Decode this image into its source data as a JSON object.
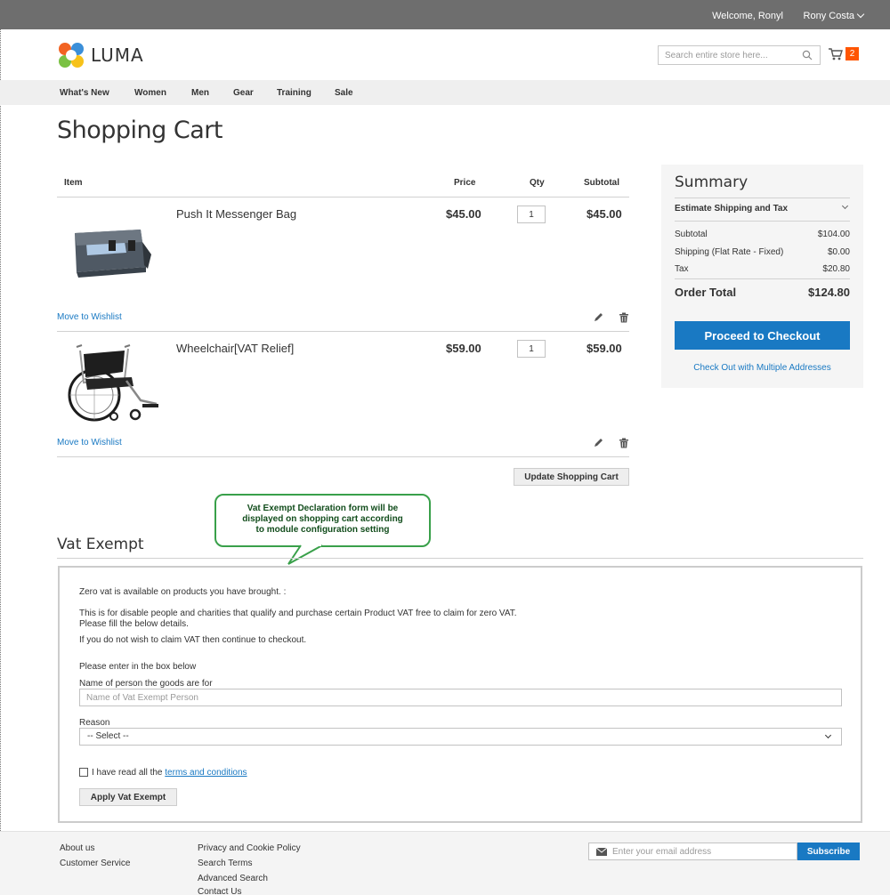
{
  "header": {
    "welcome": "Welcome, Ronyl",
    "user_name": "Rony Costa",
    "logo_text": "LUMA",
    "search_placeholder": "Search entire store here...",
    "cart_count": "2"
  },
  "nav": {
    "items": [
      "What's New",
      "Women",
      "Men",
      "Gear",
      "Training",
      "Sale"
    ]
  },
  "page_title": "Shopping Cart",
  "cart": {
    "columns": {
      "item": "Item",
      "price": "Price",
      "qty": "Qty",
      "subtotal": "Subtotal"
    },
    "items": [
      {
        "name": "Push It Messenger Bag",
        "price": "$45.00",
        "qty": "1",
        "subtotal": "$45.00",
        "wishlist": "Move to Wishlist"
      },
      {
        "name": "Wheelchair[VAT Relief]",
        "price": "$59.00",
        "qty": "1",
        "subtotal": "$59.00",
        "wishlist": "Move to Wishlist"
      }
    ],
    "update_label": "Update Shopping Cart"
  },
  "summary": {
    "title": "Summary",
    "estimate": "Estimate Shipping and Tax",
    "rows": [
      {
        "label": "Subtotal",
        "value": "$104.00"
      },
      {
        "label": "Shipping (Flat Rate - Fixed)",
        "value": "$0.00"
      },
      {
        "label": "Tax",
        "value": "$20.80"
      }
    ],
    "total_label": "Order Total",
    "total_value": "$124.80",
    "checkout_label": "Proceed to Checkout",
    "multi_label": "Check Out with Multiple Addresses"
  },
  "callout": {
    "line1": "Vat Exempt Declaration form will be",
    "line2": "displayed on shopping cart according",
    "line3": "to module configuration setting"
  },
  "vat": {
    "title": "Vat Exempt",
    "line1": "Zero vat is available on products you have brought. :",
    "line2": "This is for disable people and charities that qualify and purchase certain Product VAT free to claim for zero VAT.",
    "line3": "Please fill the below details.",
    "line4": "If you do not wish to claim VAT then continue to checkout.",
    "line5": "Please enter in the box below",
    "name_label": "Name of person the goods are for",
    "name_placeholder": "Name of Vat Exempt Person",
    "reason_label": "Reason",
    "reason_selected": "-- Select --",
    "terms_prefix": "I have read all the",
    "terms_link": "terms and conditions",
    "apply_label": "Apply Vat Exempt"
  },
  "footer": {
    "col1": [
      "About us",
      "Customer Service"
    ],
    "col2": [
      "Privacy and Cookie Policy",
      "Search Terms",
      "Advanced Search",
      "Contact Us"
    ],
    "email_placeholder": "Enter your email address",
    "subscribe_label": "Subscribe"
  },
  "colors": {
    "primary": "#1979c3",
    "badge": "#ff5501",
    "topbar": "#6e6e6e",
    "callout_border": "#39a04a"
  }
}
